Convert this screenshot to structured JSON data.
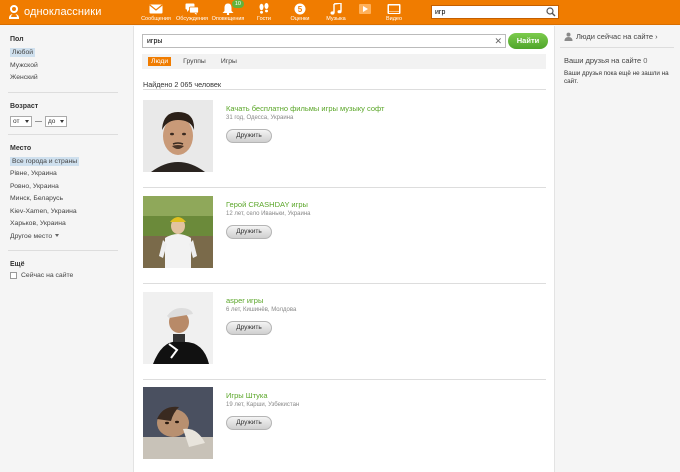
{
  "header": {
    "logo_text": "одноклассники",
    "nav": [
      {
        "label": "Сообщения",
        "icon": "envelope-icon"
      },
      {
        "label": "Обсуждения",
        "icon": "chat-bubbles-icon"
      },
      {
        "label": "Оповещения",
        "icon": "bell-icon",
        "badge": "10"
      },
      {
        "label": "Гости",
        "icon": "footprints-icon"
      },
      {
        "label": "Оценки",
        "icon": "five-coin-icon"
      },
      {
        "label": "Музыка",
        "icon": "music-note-icon"
      },
      {
        "label": "",
        "icon": "play-icon"
      },
      {
        "label": "Видео",
        "icon": "video-icon"
      }
    ],
    "search_value": "игр"
  },
  "sidebar": {
    "gender": {
      "title": "Пол",
      "options": [
        "Любой",
        "Мужской",
        "Женский"
      ],
      "selected": "Любой"
    },
    "age": {
      "title": "Возраст",
      "from": "от",
      "to": "до"
    },
    "place": {
      "title": "Место",
      "options": [
        "Все города и страны",
        "Рівне, Украина",
        "Ровно, Украина",
        "Минск, Беларусь",
        "Kiev-Xamen, Украина",
        "Харьков, Украина"
      ],
      "selected": "Все города и страны",
      "more": "Другое место"
    },
    "extra": {
      "title": "Ещё",
      "online_label": "Сейчас на сайте"
    }
  },
  "main": {
    "search_value": "игры",
    "find_button": "Найти",
    "tabs": [
      "Люди",
      "Группы",
      "Игры"
    ],
    "active_tab": "Люди",
    "found_text": "Найдено 2 065 человек",
    "results": [
      {
        "name": "Качать бесплатно фильмы игры музыку софт",
        "info": "31 год, Одесса, Украина",
        "button": "Дружить"
      },
      {
        "name": "Герой CRASHDAY игры",
        "info": "12 лет, село Иваньки, Украина",
        "button": "Дружить"
      },
      {
        "name": "asper игры",
        "info": "6 лет, Кишинёв, Молдова",
        "button": "Дружить"
      },
      {
        "name": "Игры Штука",
        "info": "19 лет, Карши, Узбекистан",
        "button": "Дружить"
      }
    ]
  },
  "right": {
    "people_online": "Люди сейчас на сайте ›",
    "friends_online_title": "Ваши друзья на сайте",
    "friends_online_count": "0",
    "friends_note": "Ваши друзья пока ещё не зашли на сайт."
  },
  "colors": {
    "brand": "#f07c00",
    "accent_green": "#5aa628"
  }
}
